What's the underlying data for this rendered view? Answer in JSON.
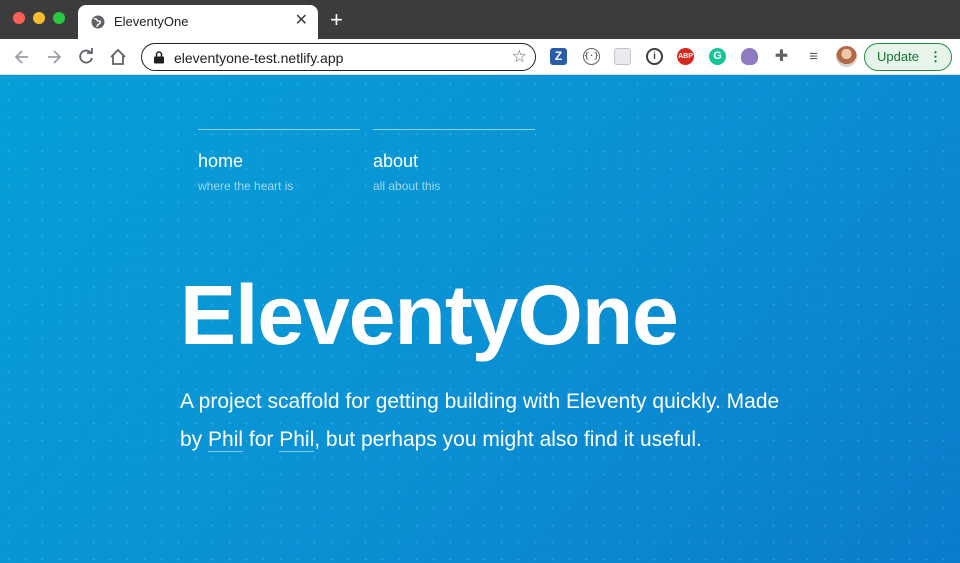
{
  "browser": {
    "tab": {
      "title": "EleventyOne",
      "close_icon": "✕"
    },
    "new_tab_icon": "+",
    "address": {
      "url": "eleventyone-test.netlify.app",
      "bookmark_icon": "☆"
    },
    "extensions": {
      "z_label": "Z",
      "brackets_label": "{·}",
      "info_label": "i",
      "abp_label": "ABP",
      "grammarly_label": "G",
      "puzzle_icon": "✚",
      "queue_icon": "≡"
    },
    "update_button": {
      "label": "Update",
      "menu_icon": "⋮"
    }
  },
  "page": {
    "nav": [
      {
        "label": "home",
        "sublabel": "where the heart is"
      },
      {
        "label": "about",
        "sublabel": "all about this"
      }
    ],
    "hero": {
      "title": "EleventyOne",
      "desc_1": "A project scaffold for getting building with Eleventy quickly. Made by ",
      "link_1": "Phil",
      "desc_2": " for ",
      "link_2": "Phil",
      "desc_3": ", but perhaps you might also find it useful."
    }
  },
  "colors": {
    "page_bg_start": "#069fd8",
    "page_bg_end": "#0b7bcb",
    "update_green": "#137333"
  }
}
